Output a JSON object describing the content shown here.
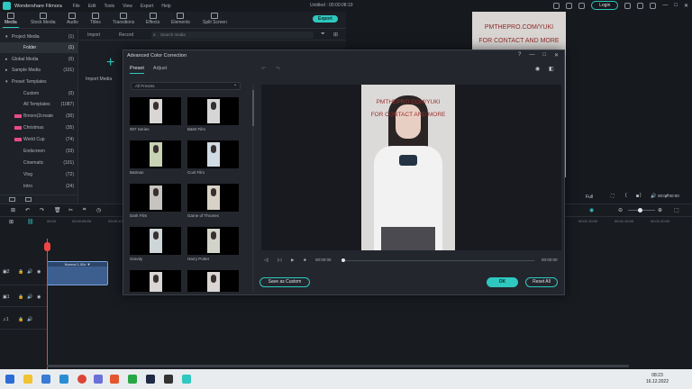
{
  "app": {
    "name": "Wondershare Filmora",
    "project_title": "Untitled : 00:00:08:19",
    "login_label": "Login"
  },
  "menu": [
    "File",
    "Edit",
    "Tools",
    "View",
    "Export",
    "Help"
  ],
  "toolbar": {
    "tabs": [
      {
        "label": "Media",
        "icon": "media-icon",
        "active": true
      },
      {
        "label": "Stock Media",
        "icon": "stock-media-icon",
        "active": false
      },
      {
        "label": "Audio",
        "icon": "audio-icon",
        "active": false
      },
      {
        "label": "Titles",
        "icon": "titles-icon",
        "active": false
      },
      {
        "label": "Transitions",
        "icon": "transitions-icon",
        "active": false
      },
      {
        "label": "Effects",
        "icon": "effects-icon",
        "active": false
      },
      {
        "label": "Elements",
        "icon": "elements-icon",
        "active": false
      },
      {
        "label": "Split Screen",
        "icon": "split-screen-icon",
        "active": false
      }
    ],
    "export_label": "Export"
  },
  "sidebar": {
    "items": [
      {
        "label": "Project Media",
        "count": "(1)",
        "arrow": "▾"
      },
      {
        "label": "Folder",
        "count": "(1)",
        "selected": true
      },
      {
        "label": "Global Media",
        "count": "(0)",
        "arrow": "▸"
      },
      {
        "label": "Sample Media",
        "count": "(101)",
        "arrow": "▸"
      },
      {
        "label": "Preset Templates",
        "count": "",
        "arrow": "▾"
      },
      {
        "label": "Custom",
        "count": "(0)"
      },
      {
        "label": "All Templates",
        "count": "(1087)"
      },
      {
        "label": "Bmore(2create",
        "count": "(30)",
        "tag": true
      },
      {
        "label": "Christmas",
        "count": "(35)",
        "tag": true
      },
      {
        "label": "World Cup",
        "count": "(74)",
        "tag": true
      },
      {
        "label": "Endscreen",
        "count": "(33)"
      },
      {
        "label": "Cinematic",
        "count": "(101)"
      },
      {
        "label": "Vlog",
        "count": "(72)"
      },
      {
        "label": "Intro",
        "count": "(24)"
      }
    ]
  },
  "media": {
    "import_label": "Import",
    "record_label": "Record",
    "search_placeholder": "Search media",
    "import_media_label": "Import Media"
  },
  "preview": {
    "watermark_line1": "PMTHEPRO.COM/YUKI",
    "watermark_line2": "FOR CONTACT AND MORE",
    "timecode": "00:00:00:00",
    "quality": "Full"
  },
  "timeline": {
    "ruler": [
      "00:00",
      "00:00:05:00",
      "00:00:10:00"
    ],
    "ruler_right": [
      "00:00:20:00",
      "00:01:10:00",
      "00:01:15:00",
      "00:01:20:00",
      "00:01:25:00"
    ],
    "clip_label": "Normal 1.00x ▼"
  },
  "dialog": {
    "title": "Advanced Color Correction",
    "tabs": [
      {
        "label": "Preset",
        "active": true
      },
      {
        "label": "Adjust",
        "active": false
      }
    ],
    "preset_filter": "All Presets",
    "presets": [
      {
        "label": "007 Series"
      },
      {
        "label": "B&W Film"
      },
      {
        "label": "Batman"
      },
      {
        "label": "Cool Film"
      },
      {
        "label": "Dark Film"
      },
      {
        "label": "Game of Thrones"
      },
      {
        "label": "Gravity"
      },
      {
        "label": "Harry Potter"
      },
      {
        "label": ""
      },
      {
        "label": ""
      }
    ],
    "time_start": "00:00:00",
    "time_end": "00:00:00",
    "progress": 0,
    "save_label": "Save as Custom",
    "ok_label": "OK",
    "reset_label": "Reset All"
  },
  "taskbar": {
    "time": "08:23",
    "date": "16.12.2022"
  },
  "colors": {
    "accent": "#2ec8c0",
    "clip": "#3d5f8f",
    "playhead": "#ee4444"
  }
}
